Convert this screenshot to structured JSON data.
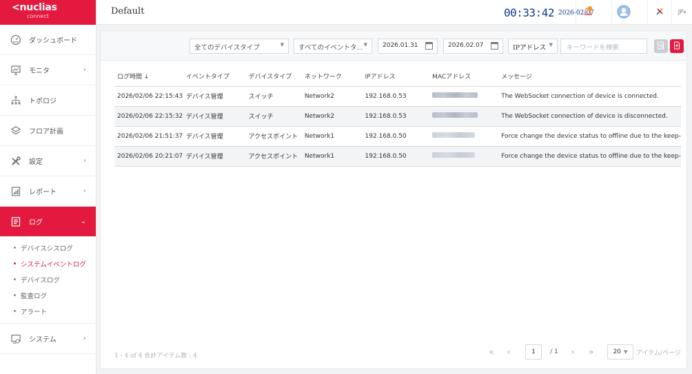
{
  "app": {
    "logo_text": "nuclias",
    "logo_sub": "connect"
  },
  "header": {
    "title": "Default",
    "clock_time": "00:33:42",
    "clock_date": "2026-02-07",
    "lang": "JP"
  },
  "sidebar": {
    "items": [
      {
        "label": "ダッシュボード",
        "icon": "dashboard-icon"
      },
      {
        "label": "モニタ",
        "icon": "monitor-icon",
        "arrow": "›"
      },
      {
        "label": "トポロジ",
        "icon": "topology-icon"
      },
      {
        "label": "フロア計画",
        "icon": "floorplan-icon"
      },
      {
        "label": "設定",
        "icon": "settings-icon",
        "arrow": "›"
      },
      {
        "label": "レポート",
        "icon": "report-icon",
        "arrow": "›"
      },
      {
        "label": "ログ",
        "icon": "log-icon",
        "arrow": "⌄",
        "active": true
      },
      {
        "label": "システム",
        "icon": "system-icon",
        "arrow": "›"
      }
    ],
    "log_sub": [
      {
        "label": "デバイスシスログ"
      },
      {
        "label": "システムイベントログ",
        "active": true
      },
      {
        "label": "デバイスログ"
      },
      {
        "label": "監査ログ"
      },
      {
        "label": "アラート"
      }
    ]
  },
  "filters": {
    "device_type": "全てのデバイスタイプ",
    "event_type": "すべてのイベントタ...",
    "date_from": "2026.01.31",
    "date_to": "2026.02.07",
    "ip_select": "IPアドレス",
    "search_placeholder": "キーワードを検索"
  },
  "table": {
    "headers": [
      "ログ時間 ↓",
      "イベントタイプ",
      "デバイスタイプ",
      "ネットワーク",
      "IPアドレス",
      "MACアドレス",
      "メッセージ"
    ],
    "rows": [
      [
        "2026/02/06 22:15:43",
        "デバイス管理",
        "スイッチ",
        "Network2",
        "192.168.0.53",
        "The WebSocket connection of device is connected."
      ],
      [
        "2026/02/06 22:15:32",
        "デバイス管理",
        "スイッチ",
        "Network2",
        "192.168.0.53",
        "The WebSocket connection of device is disconnected."
      ],
      [
        "2026/02/06 21:51:37",
        "デバイス管理",
        "アクセスポイント",
        "Network1",
        "192.168.0.50",
        "Force change the device status to offline due to the keep-"
      ],
      [
        "2026/02/06 20:21:07",
        "デバイス管理",
        "アクセスポイント",
        "Network1",
        "192.168.0.50",
        "Force change the device status to offline due to the keep-"
      ]
    ]
  },
  "footer": {
    "summary": "1 - 4 of 4 合計アイテム数 : 4",
    "first": "«",
    "prev": "‹",
    "page": "1",
    "of": "/ 1",
    "next": "›",
    "last": "»",
    "page_size": "20",
    "per_page": "アイテム/ページ"
  },
  "colors": {
    "brand": "#e3193f",
    "clock": "#0b3a8f"
  }
}
